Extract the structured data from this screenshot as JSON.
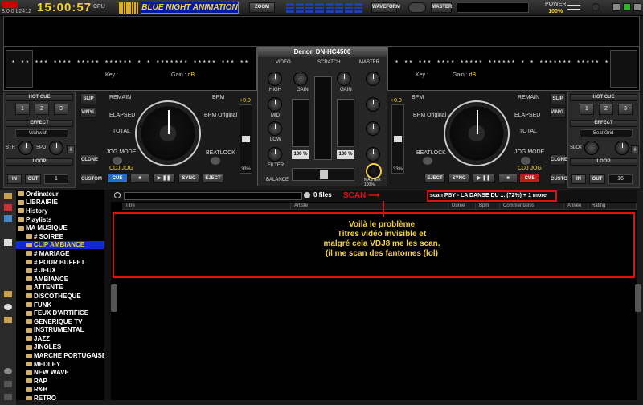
{
  "topbar": {
    "version": "8.0.0 b2412",
    "clock": "15:00:57",
    "cpu_label": "CPU",
    "skin_name": "BLUE NIGHT ANIMATION",
    "zoom_label": "ZOOM",
    "waveform_label": "WAVEFORM",
    "master_label": "MASTER",
    "power_label": "POWER",
    "power_value": "100%"
  },
  "deck_left": {
    "title": "* ** *** **** ***** ****** * * ******* ***** *** **",
    "key_label": "Key :",
    "gain_label": "Gain :",
    "gain_unit": "dB",
    "hotcue_label": "HOT CUE",
    "hotcues": [
      "1",
      "2",
      "3"
    ],
    "effect_label": "EFFECT",
    "effect_name": "Wahwah",
    "param1": "STR",
    "param2": "SPD",
    "loop_label": "LOOP",
    "in_label": "IN",
    "out_label": "OUT",
    "loop_value": "1",
    "slip": "SLIP",
    "vinyl": "VINYL",
    "clone": "CLONE",
    "custom": "CUSTOM",
    "remain": "REMAIN",
    "elapsed": "ELAPSED",
    "total": "TOTAL",
    "bpm": "BPM",
    "bpm_original": "BPM Original",
    "jog_mode": "JOG MODE",
    "beatlock": "BEATLOCK",
    "cdj_jog": "CDJ JOG",
    "cue": "CUE",
    "sync": "SYNC",
    "eject": "EJECT",
    "pitch": "+0.0",
    "pitch_range": "33%"
  },
  "deck_right": {
    "title": "* ** *** **** ***** ****** * * ******* ***** *** **",
    "key_label": "Key :",
    "gain_label": "Gain :",
    "gain_unit": "dB",
    "hotcue_label": "HOT CUE",
    "hotcues": [
      "1",
      "2",
      "3"
    ],
    "effect_label": "EFFECT",
    "effect_name": "Beat Grid",
    "param1": "SLOT",
    "loop_label": "LOOP",
    "in_label": "IN",
    "out_label": "OUT",
    "loop_value": "16",
    "slip": "SLIP",
    "vinyl": "VINYL",
    "clone": "CLONE",
    "custom": "CUSTOM",
    "remain": "REMAIN",
    "elapsed": "ELAPSED",
    "total": "TOTAL",
    "bpm": "BPM",
    "bpm_original": "BPM Original",
    "jog_mode": "JOG MODE",
    "beatlock": "BEATLOCK",
    "cdj_jog": "CDJ JOG",
    "cue": "CUE",
    "sync": "SYNC",
    "eject": "EJECT",
    "pitch": "+0.0",
    "pitch_range": "33%"
  },
  "mixer": {
    "title": "Denon DN-HC4500",
    "video": "VIDEO",
    "scratch": "SCRATCH",
    "master": "MASTER",
    "gain": "GAIN",
    "high": "HIGH",
    "mid": "MID",
    "low": "LOW",
    "filter": "FILTER",
    "balance": "BALANCE",
    "left_pct": "100 %",
    "right_pct": "100 %",
    "master_vol": "MASTER",
    "master_vol_pct": "100%"
  },
  "folders": [
    {
      "label": "Ordinateur",
      "level": 0
    },
    {
      "label": "LIBRAIRIE",
      "level": 0
    },
    {
      "label": "History",
      "level": 0
    },
    {
      "label": "Playlists",
      "level": 0
    },
    {
      "label": "MA MUSIQUE",
      "level": 0
    },
    {
      "label": "# SOIREE",
      "level": 1
    },
    {
      "label": "CLIP AMBIANCE",
      "level": 1,
      "selected": true
    },
    {
      "label": "# MARIAGE",
      "level": 1
    },
    {
      "label": "# POUR BUFFET",
      "level": 1
    },
    {
      "label": "# JEUX",
      "level": 1
    },
    {
      "label": "AMBIANCE",
      "level": 1
    },
    {
      "label": "ATTENTE",
      "level": 1
    },
    {
      "label": "DISCOTHEQUE",
      "level": 1
    },
    {
      "label": "FUNK",
      "level": 1
    },
    {
      "label": "FEUX D'ARTIFICE",
      "level": 1
    },
    {
      "label": "GENERIQUE TV",
      "level": 1
    },
    {
      "label": "INSTRUMENTAL",
      "level": 1
    },
    {
      "label": "JAZZ",
      "level": 1
    },
    {
      "label": "JINGLES",
      "level": 1
    },
    {
      "label": "MARCHE PORTUGAISE",
      "level": 1
    },
    {
      "label": "MEDLEY",
      "level": 1
    },
    {
      "label": "NEW WAVE",
      "level": 1
    },
    {
      "label": "RAP",
      "level": 1
    },
    {
      "label": "R&B",
      "level": 1
    },
    {
      "label": "RETRO",
      "level": 1
    }
  ],
  "browser": {
    "files_count": "0 files",
    "scan_label": "SCAN",
    "scan_status": "scan PSY - LA DANSE DU ... (72%) + 1 more",
    "columns": [
      "Titre",
      "Artiste",
      "Durée",
      "Bpm",
      "Commentaires",
      "Année",
      "Rating"
    ],
    "annotation": [
      "Voilà le problème",
      "Titres vidéo invisible et",
      "malgré cela VDJ8 me les scan.",
      "(il me scan des fantomes (lol)"
    ]
  },
  "colors": {
    "accent_yellow": "#f3d23a",
    "highlight_blue": "#1028d6",
    "annotation_red": "#e01010"
  }
}
